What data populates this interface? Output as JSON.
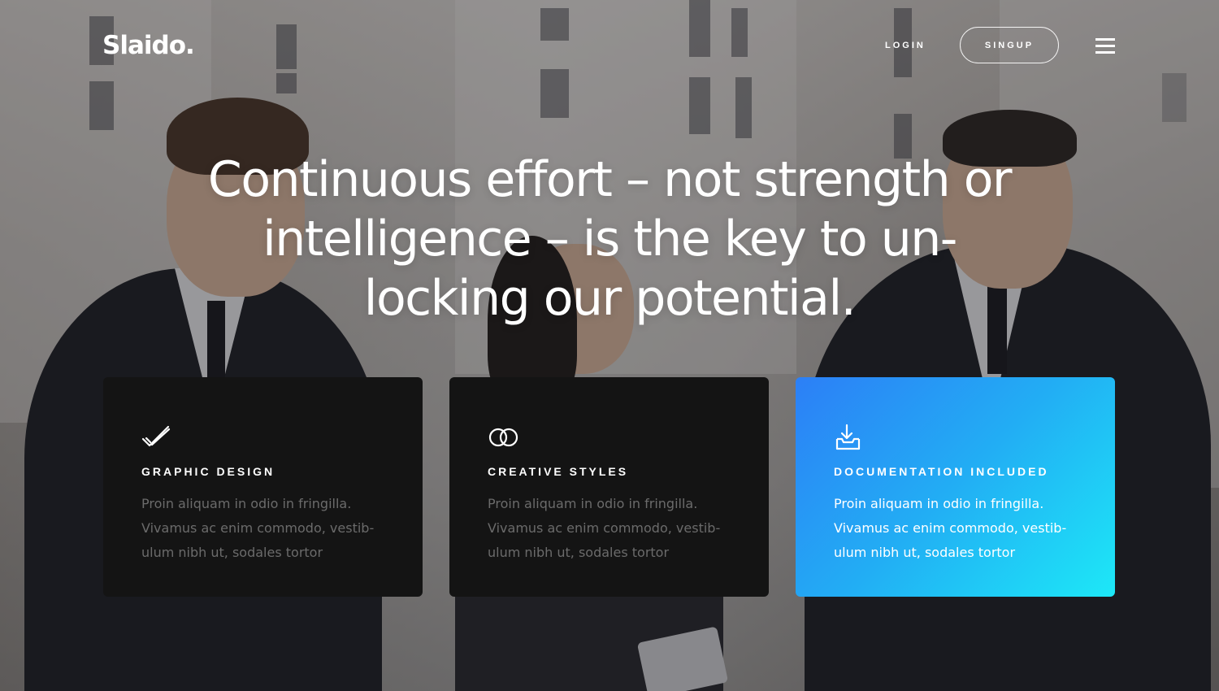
{
  "header": {
    "logo": "Slaido.",
    "login_label": "LOGIN",
    "signup_label": "SINGUP",
    "menu_icon": "hamburger-menu-icon"
  },
  "hero": {
    "headline": "Continuous effort – not strength or intelligence – is the key to un-locking our potential."
  },
  "features": [
    {
      "icon": "check-icon",
      "title": "GRAPHIC DESIGN",
      "text": "Proin aliquam in odio in fringilla. Vivamus ac enim commodo, vestib-ulum nibh ut, sodales tortor"
    },
    {
      "icon": "linked-circles-icon",
      "title": "CREATIVE STYLES",
      "text": "Proin aliquam in odio in fringilla. Vivamus ac enim commodo, vestib-ulum nibh ut, sodales tortor"
    },
    {
      "icon": "download-tray-icon",
      "title": "DOCUMENTATION INCLUDED",
      "text": "Proin aliquam in odio in fringilla. Vivamus ac enim commodo, vestib-ulum nibh ut, sodales tortor"
    }
  ],
  "colors": {
    "card_dark": "#141414",
    "card_accent_start": "#2c7ff6",
    "card_accent_end": "#1de8f7"
  }
}
